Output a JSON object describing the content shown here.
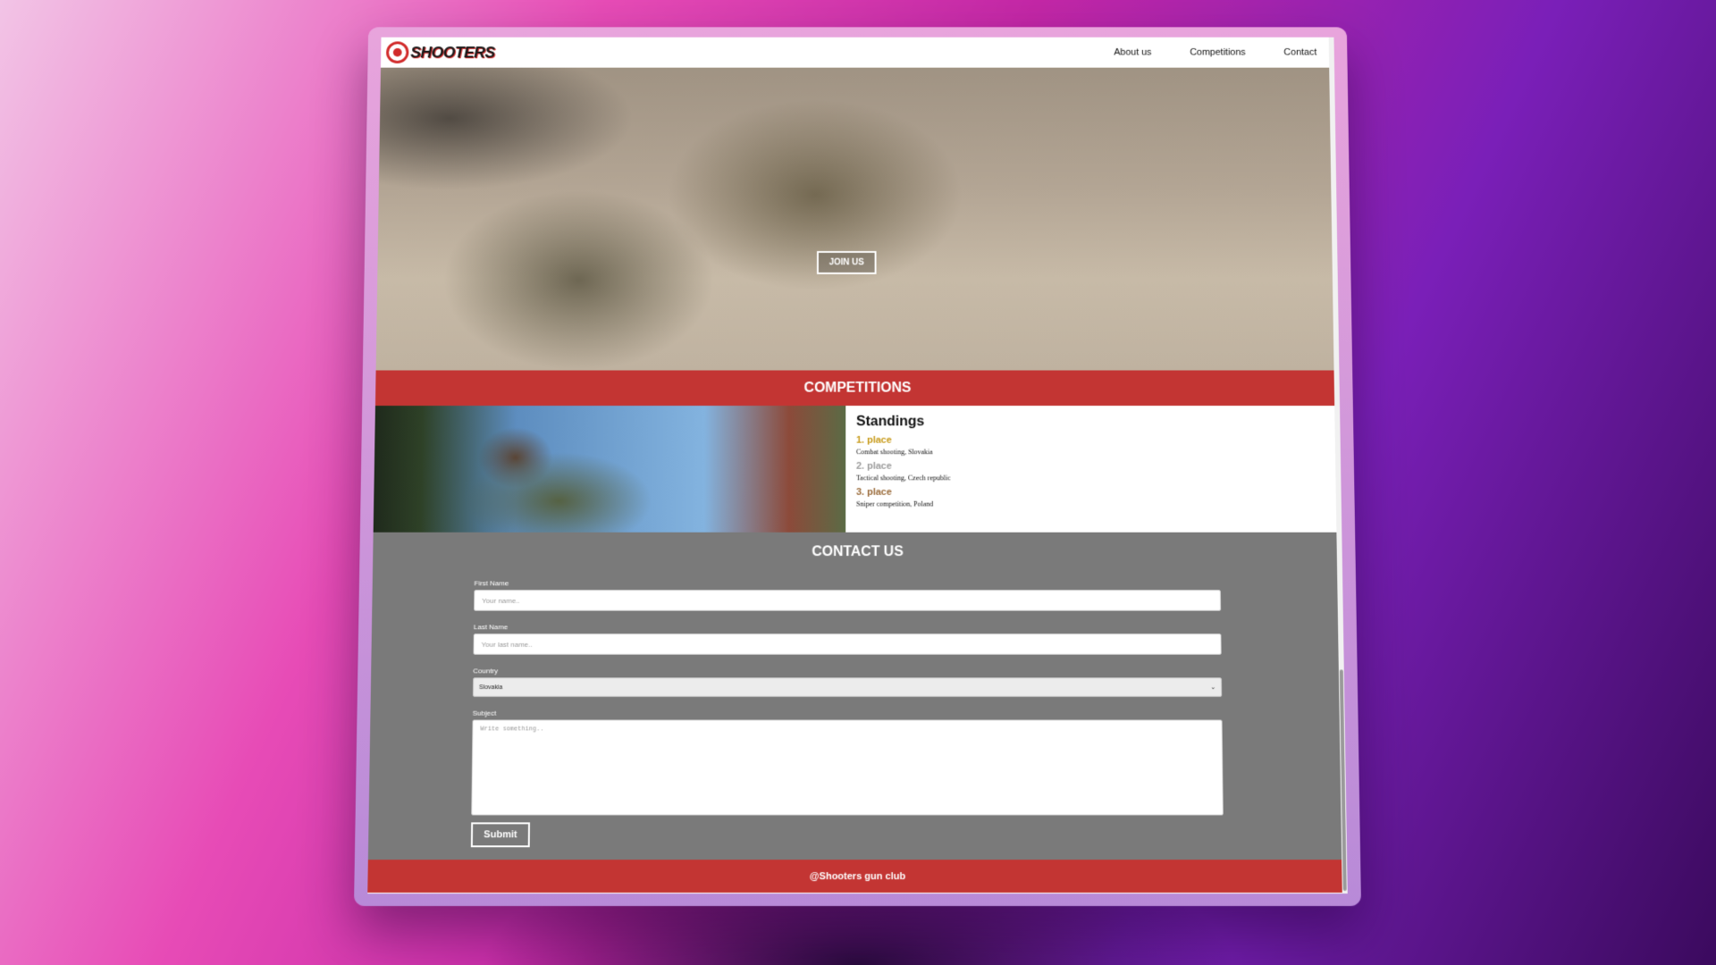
{
  "brand": {
    "logo_text": "SHOOTERS"
  },
  "nav": {
    "links": [
      "About us",
      "Competitions",
      "Contact"
    ]
  },
  "hero": {
    "cta_label": "JOIN US"
  },
  "competitions": {
    "heading": "COMPETITIONS",
    "standings_title": "Standings",
    "places": [
      {
        "label": "1. place",
        "description": "Combat shooting, Slovakia"
      },
      {
        "label": "2. place",
        "description": "Tactical shooting, Czech republic"
      },
      {
        "label": "3. place",
        "description": "Sniper competition, Poland"
      }
    ]
  },
  "contact": {
    "heading": "CONTACT US",
    "first_name": {
      "label": "First Name",
      "placeholder": "Your name.."
    },
    "last_name": {
      "label": "Last Name",
      "placeholder": "Your last name.."
    },
    "country": {
      "label": "Country",
      "value": "Slovakia"
    },
    "subject": {
      "label": "Subject",
      "placeholder": "Write something.."
    },
    "submit_label": "Submit"
  },
  "footer": {
    "text": "@Shooters gun club"
  },
  "colors": {
    "accent_red": "#c33533",
    "contact_bg": "#7a7a7a",
    "first_place": "#c79a19",
    "second_place": "#9c9c9c",
    "third_place": "#9a6b3a"
  }
}
